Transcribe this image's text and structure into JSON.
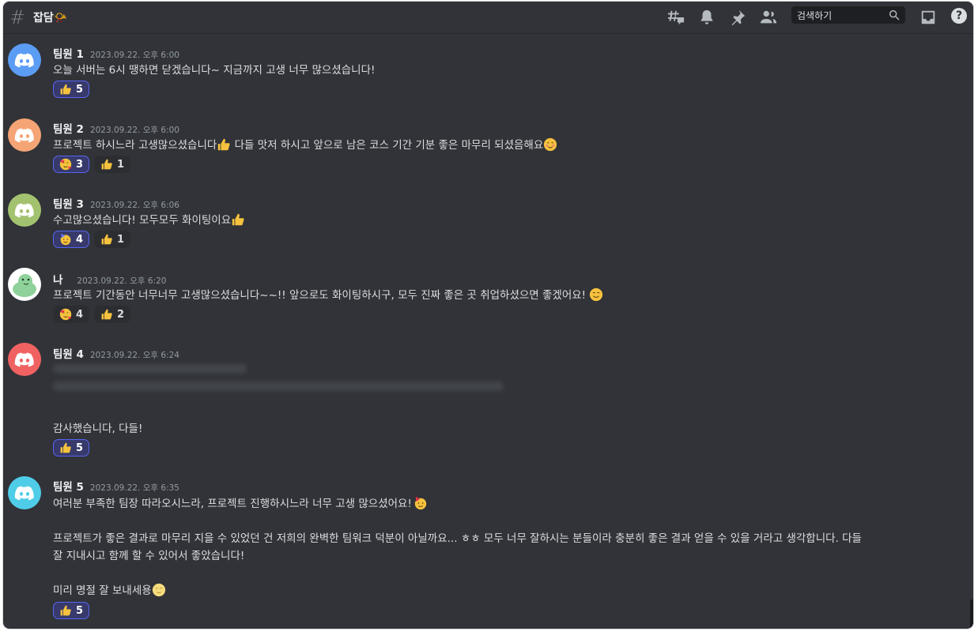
{
  "channel": {
    "title": "잡담📯"
  },
  "search": {
    "placeholder": "검색하기"
  },
  "toolbar": {
    "help": "?"
  },
  "colors": {
    "background": "#313338",
    "accent": "#5865f2"
  },
  "icons": [
    "threads-icon",
    "bell-icon",
    "pin-icon",
    "members-icon",
    "search-icon",
    "inbox-icon",
    "help-icon"
  ],
  "messages": [
    {
      "author": "팀원 1",
      "time": "2023.09.22. 오후 6:00",
      "avatar_color": "#5865f2",
      "lines": [
        "오늘 서버는 6시 땡하면 닫겠습니다~ 지금까지 고생 너무 많으셨습니다!"
      ],
      "reactions": [
        {
          "emoji": "thumbs-up",
          "count": "5",
          "me": true
        }
      ]
    },
    {
      "author": "팀원 2",
      "time": "2023.09.22. 오후 6:00",
      "avatar_color": "#f0986c",
      "lines": [
        "프로젝트 하시느라 고생많으셨습니다",
        " 다들 맛저 하시고 앞으로 남은 코스 기간 기분 좋은 마무리 되셨음해요"
      ],
      "reactions": [
        {
          "emoji": "hearts-face",
          "count": "3",
          "me": true
        },
        {
          "emoji": "thumbs-up",
          "count": "1",
          "me": false
        }
      ]
    },
    {
      "author": "팀원 3",
      "time": "2023.09.22. 오후 6:06",
      "avatar_color": "#8fb85a",
      "lines": [
        "수고많으셨습니다! 모두모두 화이팅이요"
      ],
      "reactions": [
        {
          "emoji": "party-face",
          "count": "4",
          "me": true
        },
        {
          "emoji": "thumbs-up",
          "count": "1",
          "me": false
        }
      ]
    },
    {
      "author": "나",
      "time": "2023.09.22. 오후 6:20",
      "avatar_color": "#ffffff",
      "lines": [
        "프로젝트 기간동안 너무너무 고생많으셨습니다~~!! 앞으로도 화이팅하시구, 모두 진짜 좋은 곳 취업하셨으면 좋겠어요!"
      ],
      "reactions": [
        {
          "emoji": "hearts-face",
          "count": "4",
          "me": false
        },
        {
          "emoji": "thumbs-up",
          "count": "2",
          "me": false
        }
      ]
    },
    {
      "author": "팀원 4",
      "time": "2023.09.22. 오후 6:24",
      "avatar_color": "#f05a5a",
      "lines": [
        "감사했습니다, 다들!"
      ],
      "reactions": [
        {
          "emoji": "thumbs-up",
          "count": "5",
          "me": true
        }
      ]
    },
    {
      "author": "팀원 5",
      "time": "2023.09.22. 오후 6:35",
      "avatar_color": "#3fc4e0",
      "lines": [
        "여러분 부족한 팀장 따라오시느라, 프로젝트 진행하시느라 너무 고생 많으셨어요!",
        "프로젝트가 좋은 결과로 마무리 지을 수 있었던 건 저희의 완벽한 팀워크 덕분이 아닐까요... ㅎㅎ 모두 너무 잘하시는 분들이라 충분히 좋은 결과 얻을 수 있을 거라고 생각합니다. 다들",
        "잘 지내시고 함께 할 수 있어서 좋았습니다!",
        "미리 명절 잘 보내세용"
      ],
      "reactions": [
        {
          "emoji": "thumbs-up",
          "count": "5",
          "me": true
        }
      ]
    }
  ]
}
